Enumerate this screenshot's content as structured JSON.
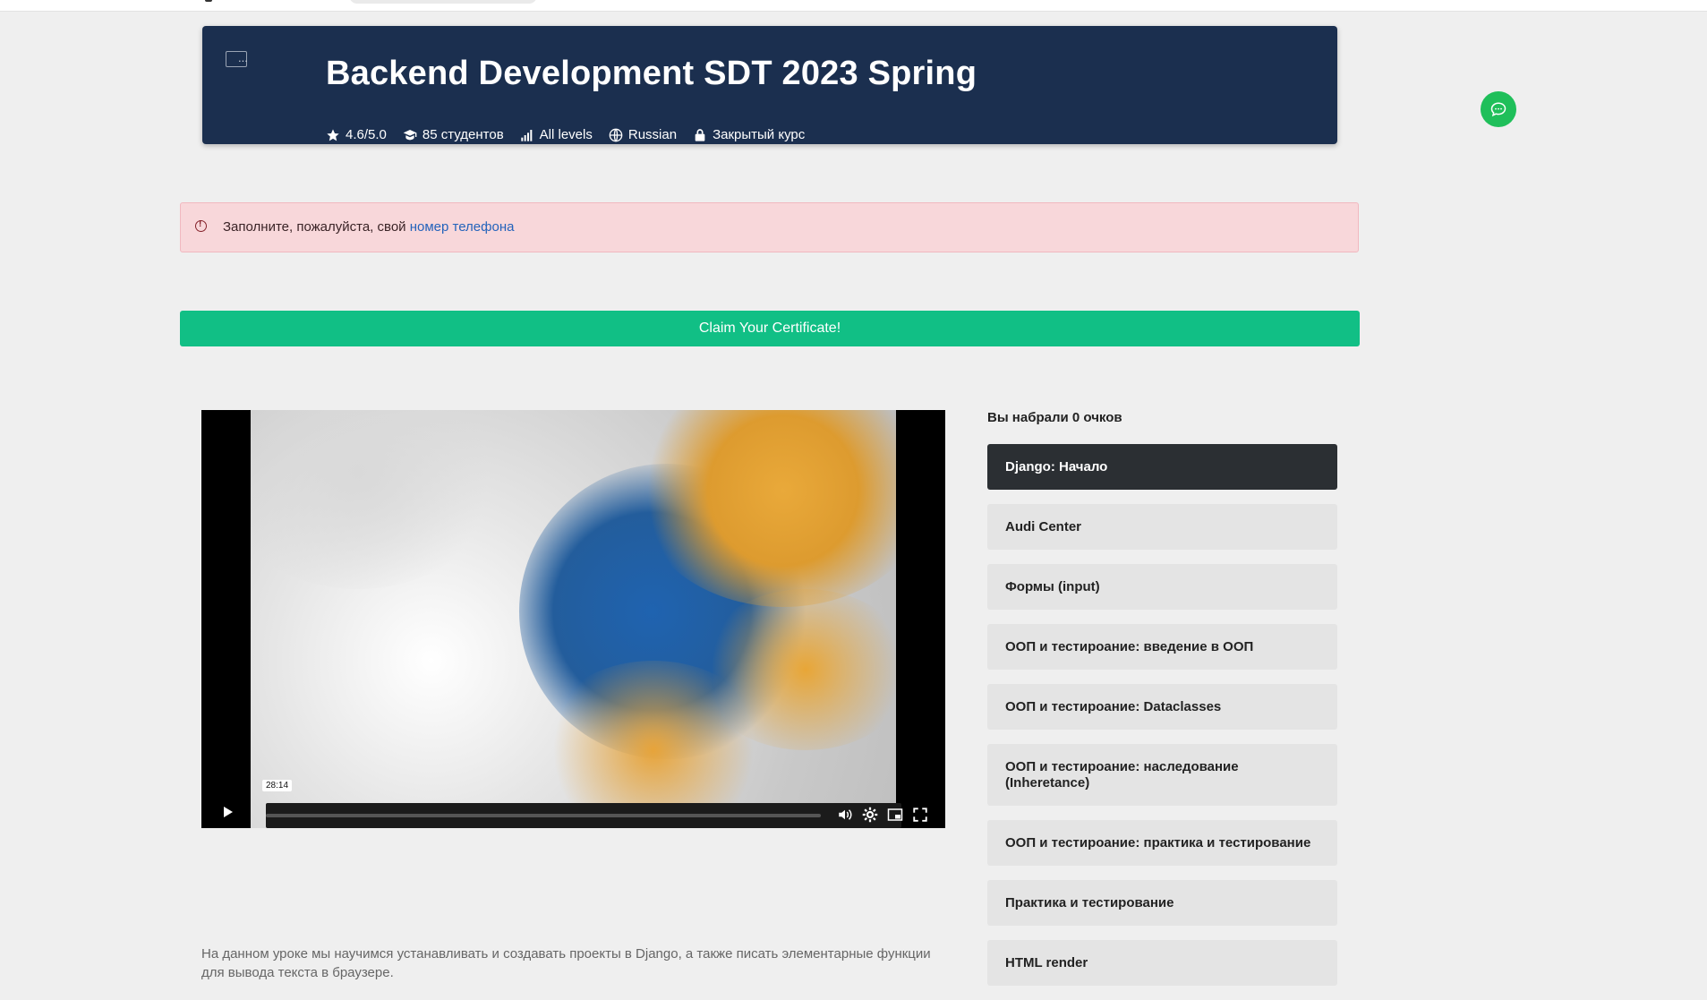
{
  "course": {
    "title": "Backend Development SDT 2023 Spring",
    "thumbnail_alt": "...",
    "rating": "4.6/5.0",
    "students": "85 студентов",
    "level": "All levels",
    "language": "Russian",
    "access": "Закрытый курс"
  },
  "alert": {
    "text": "Заполните, пожалуйста, свой ",
    "link": "номер телефона"
  },
  "certificate_button": "Claim Your Certificate!",
  "video": {
    "time_tooltip": "28:14"
  },
  "description": "На данном уроке мы научимся устанавливать и создавать проекты в Django, а также писать элементарные функции для вывода текста в браузере.",
  "score_text": "Вы набрали 0 очков",
  "lessons": [
    {
      "label": "Django: Начало",
      "active": true
    },
    {
      "label": "Audi Center"
    },
    {
      "label": "Формы (input)"
    },
    {
      "label": "ООП и тестироание: введение в ООП"
    },
    {
      "label": "ООП и тестироание: Dataclasses"
    },
    {
      "label": "ООП и тестироание: наследование (Inheretance)"
    },
    {
      "label": "ООП и тестироание: практика и тестирование"
    },
    {
      "label": "Практика и тестирование"
    },
    {
      "label": "HTML render"
    }
  ],
  "colors": {
    "hero_bg": "#1b2f4f",
    "certificate_green": "#11bf85",
    "alert_bg": "#f8d7da",
    "chat_green": "#1fbf5a"
  }
}
